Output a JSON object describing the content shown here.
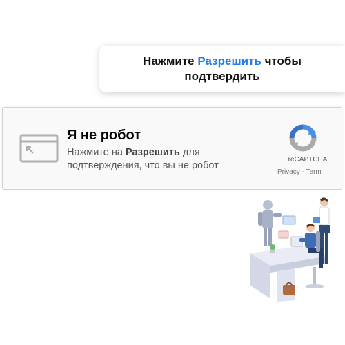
{
  "prompt": {
    "before": "Нажмите ",
    "highlight": "Разрешить",
    "after": " чтобы",
    "line2": "подтвердить"
  },
  "captcha": {
    "title": "Я не робот",
    "desc_before": "Нажмите на ",
    "desc_bold": "Разрешить",
    "desc_after": " для подтверждения, что вы не робот",
    "brand": "reCAPTCHA",
    "privacy": "Privacy",
    "separator": " - ",
    "terms": "Term"
  },
  "colors": {
    "accent": "#1f7ee8",
    "widget_bg": "#f9f9f9",
    "recaptcha_blue": "#4a90e2",
    "recaptcha_gray": "#aaaaaa"
  },
  "icons": [
    "browser-window-icon",
    "recaptcha-logo-icon",
    "office-illustration"
  ]
}
